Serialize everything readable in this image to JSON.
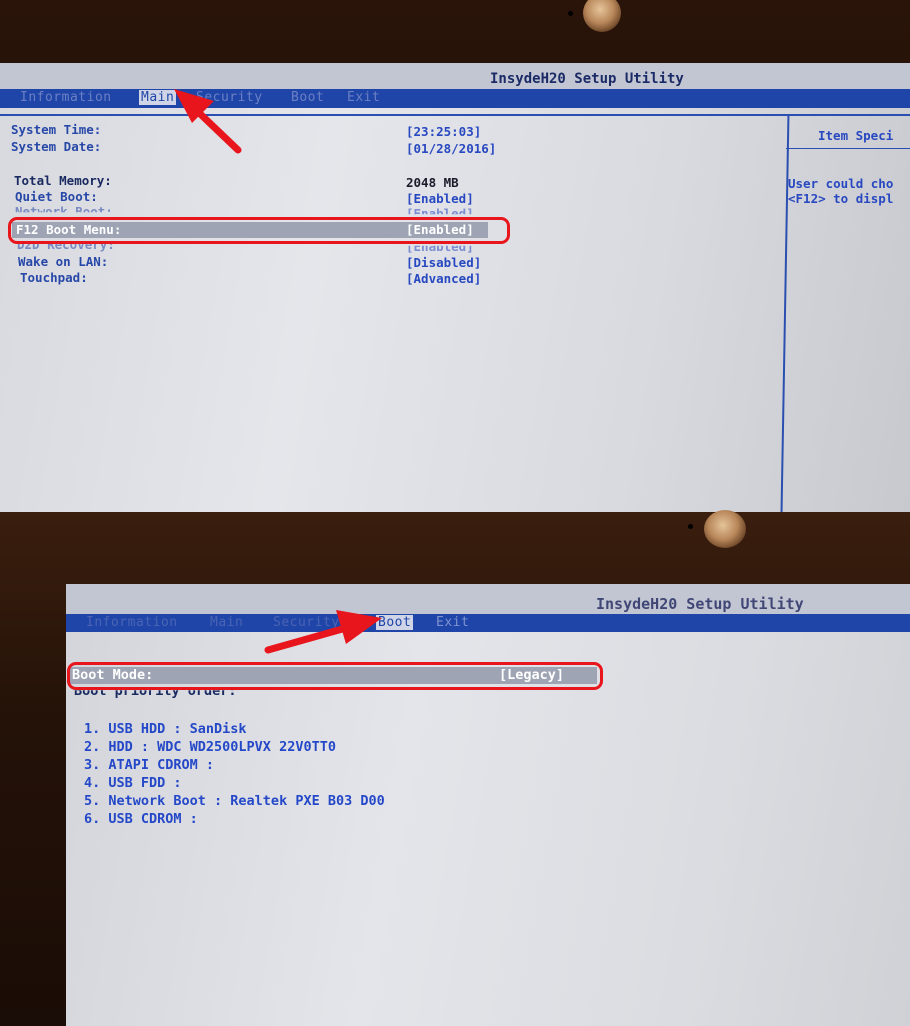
{
  "top_screen": {
    "app_title": "InsydeH20 Setup Utility",
    "menu": [
      {
        "label": "Information"
      },
      {
        "label": "Main"
      },
      {
        "label": "Security"
      },
      {
        "label": "Boot"
      },
      {
        "label": "Exit"
      }
    ],
    "settings": [
      {
        "label": "System Time:",
        "value": "[23:25:03]"
      },
      {
        "label": "System Date:",
        "value": "[01/28/2016]"
      },
      {
        "label": "Total Memory:",
        "value": "2048 MB"
      },
      {
        "label": "Quiet Boot:",
        "value": "[Enabled]"
      },
      {
        "label": "Network Boot:",
        "value": "[Enabled]"
      },
      {
        "label": "F12 Boot Menu:",
        "value": "[Enabled]"
      },
      {
        "label": "D2D Recovery:",
        "value": "[Enabled]"
      },
      {
        "label": "Wake on LAN:",
        "value": "[Disabled]"
      },
      {
        "label": "Touchpad:",
        "value": "[Advanced]"
      }
    ],
    "help_panel": {
      "title": "Item Speci",
      "line1": "User could cho",
      "line2": "<F12> to displ"
    }
  },
  "bottom_screen": {
    "app_title": "InsydeH20 Setup Utility",
    "menu": [
      {
        "label": "Information"
      },
      {
        "label": "Main"
      },
      {
        "label": "Security"
      },
      {
        "label": "Boot"
      },
      {
        "label": "Exit"
      }
    ],
    "boot_mode": {
      "label": "Boot Mode:",
      "value": "[Legacy]"
    },
    "boot_priority_label": "Boot priority order:",
    "boot_priority": [
      "1.  USB HDD : SanDisk",
      "2.  HDD : WDC WD2500LPVX 22V0TT0",
      "3.  ATAPI CDROM :",
      "4.  USB FDD :",
      "5.  Network Boot : Realtek PXE B03 D00",
      "6.  USB CDROM :"
    ]
  },
  "colors": {
    "menu_bar": "#1f45a8",
    "annotation": "#e8161c",
    "value_text": "#2848c0"
  }
}
